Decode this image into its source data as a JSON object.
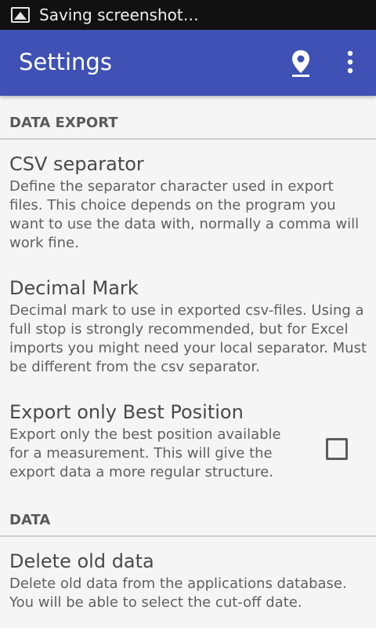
{
  "status_bar": {
    "notification_text": "Saving screenshot…",
    "icon": "image-icon"
  },
  "app_bar": {
    "title": "Settings",
    "location_icon": "location-pin-icon",
    "menu_icon": "overflow-menu-icon",
    "color": "#3f51b5"
  },
  "sections": [
    {
      "title": "DATA EXPORT",
      "items": [
        {
          "title": "CSV separator",
          "summary": "Define the separator character used in export files. This choice depends on the program you want to use the data with, normally a comma will work fine."
        },
        {
          "title": "Decimal Mark",
          "summary": "Decimal mark to use in exported csv-files. Using a full stop is strongly recommended, but for Excel imports you might need your local separator. Must be different from the csv separator."
        },
        {
          "title": "Export only Best Position",
          "summary": "Export only the best position available for a measurement. This will give the export data a more regular structure.",
          "checked": false
        }
      ]
    },
    {
      "title": "DATA",
      "items": [
        {
          "title": "Delete old data",
          "summary": "Delete old data from the applications database. You will be able to select the cut-off date."
        }
      ]
    }
  ]
}
